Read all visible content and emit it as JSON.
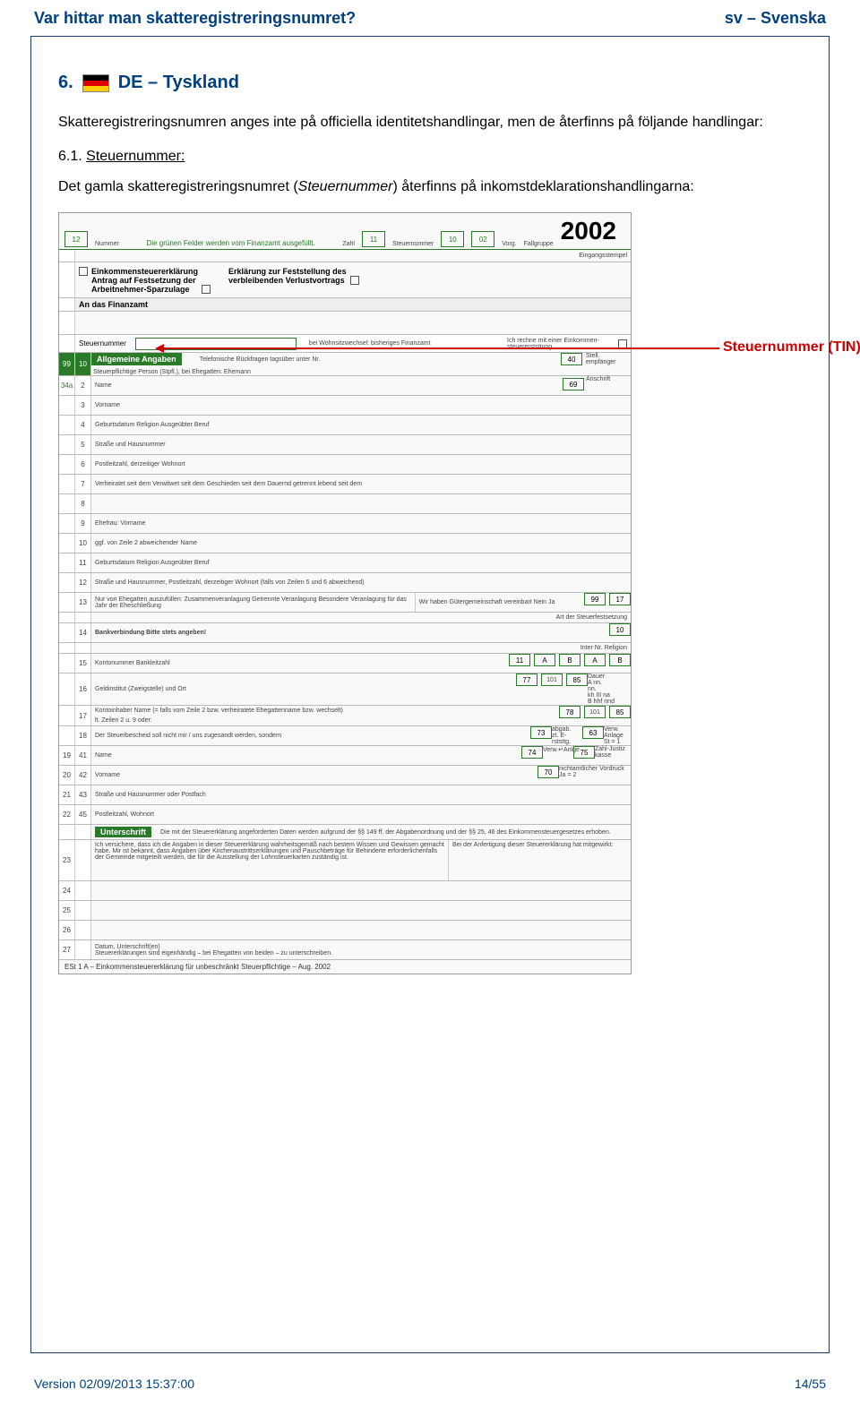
{
  "header": {
    "title_left": "Var hittar man skatteregistreringsnumret?",
    "title_right": "sv – Svenska"
  },
  "section": {
    "number": "6.",
    "country": "DE – Tyskland",
    "intro": "Skatteregistreringsnumren anges inte på officiella identitetshandlingar, men de återfinns på följande handlingar:",
    "sub_number": "6.1.",
    "sub_title": "Steuernummer:",
    "sub_body_prefix": "Det gamla skatteregistreringsnumret (",
    "sub_body_ital": "Steuernummer",
    "sub_body_suffix": ") återfinns på inkomstdeklarationshandlingarna:"
  },
  "annotation": {
    "label": "Steuernummer (TIN)"
  },
  "form": {
    "green_note": "Die grünen Felder werden vom Finanzamt ausgefüllt.",
    "year": "2002",
    "cells_top": [
      "12",
      "11",
      "10",
      "02"
    ],
    "top_small_labels": [
      "Nummer",
      "Zahl",
      "Steuernummer",
      "Vorg.",
      "Fallgruppe"
    ],
    "eingang": "Eingangsstempel",
    "decl_block": {
      "l1": "Einkommensteuererklärung",
      "l2": "Antrag auf Festsetzung der",
      "l3": "Arbeitnehmer-Sparzulage",
      "r1": "Erklärung zur Feststellung des",
      "r2": "verbleibenden Verlustvortrags"
    },
    "an_das": "An das Finanzamt",
    "steuer_label": "Steuernummer",
    "wohnsitz": "bei Wohnsitzwechsel: bisheriges Finanzamt",
    "rechne": "Ich rechne mit einer Einkommen-steuererststtung.",
    "allg": "Allgemeine Angaben",
    "allg_sub": "Steuerpflichtige Person (Stpfl.), bei Ehegatten: Ehemann",
    "tele": "Telefonische Rückfragen tagsüber unter Nr.",
    "rows": [
      {
        "n": "2",
        "t": "Name"
      },
      {
        "n": "3",
        "t": "Vorname"
      },
      {
        "n": "4",
        "t": "Geburtsdatum            Religion            Ausgeübter Beruf"
      },
      {
        "n": "5",
        "t": "Straße und Hausnummer"
      },
      {
        "n": "6",
        "t": "Postleitzahl, derzeitiger Wohnort"
      },
      {
        "n": "7",
        "t": "Verheiratet seit dem    Verwitwet seit dem    Geschieden seit dem    Dauernd getrennt lebend seit dem"
      },
      {
        "n": "8",
        "t": ""
      },
      {
        "n": "9",
        "t": "Ehefrau: Vorname"
      },
      {
        "n": "10",
        "t": "ggf. von Zeile 2 abweichender Name"
      },
      {
        "n": "11",
        "t": "Geburtsdatum            Religion            Ausgeübter Beruf"
      },
      {
        "n": "12",
        "t": "Straße und Hausnummer, Postleitzahl, derzeitiger Wohnort (falls von Zeilen 5 und 6 abweichend)"
      }
    ],
    "row13_left": "Nur von Ehegatten auszufüllen:  Zusammenveranlagung   Getrennte Veranlagung   Besondere Veranlagung für das Jahr der Eheschließung",
    "row13_right": "Wir haben Gütergemeinschaft vereinbart   Nein   Ja",
    "row14": "Bankverbindung   Bitte stets angeben!",
    "row15": "Kontonummer                                   Bankleitzahl",
    "row16": "Geldinstitut (Zweigstelle) und Ort",
    "row17": "Kontoinhaber   Name (= falls vom Zeile 2 bzw. verheiratete Ehegattenname bzw. wechselt)",
    "row17b": "lt. Zeilen 2 u. 9 oder:",
    "row18": "Der Steuerbescheid soll nicht mir / uns zugesandt werden, sondern",
    "row19": "Name",
    "row20": "Vorname",
    "row21": "Straße und Hausnummer oder Postfach",
    "row22": "Postleitzahl, Wohnort",
    "unterschrift": "Unterschrift",
    "unter_note": "Die mit der Steuererklärung angeforderten Daten werden aufgrund der §§ 149 ff. der Abgabenordnung und der §§ 25, 46 des Einkommensteuergesetzes erhoben.",
    "row23": "Ich versichere, dass ich die Angaben in dieser Steuererklärung wahrheitsgemäß nach bestem Wissen und Gewissen gemacht habe. Mir ist bekannt, dass Angaben über Kirchenaustrittserklärungen und Pauschbeträge für Behinderte erforderlichenfalls der Gemeinde mitgeteilt werden, die für die Ausstellung der Lohnsteuerkarten zuständig ist.",
    "row23r": "Bei der Anfertigung dieser Steuererklärung hat mitgewirkt:",
    "row27": "Datum, Unterschrift(en)\nSteuererklärungen sind eigenhändig – bei Ehegatten von beiden – zu unterschreiben.",
    "footer": "ESt 1 A – Einkommensteuererklärung für unbeschränkt Steuerpflichtige – Aug. 2002",
    "right_codes": {
      "r1": [
        "99",
        "10"
      ],
      "r1b": [
        "40"
      ],
      "r1c": "69",
      "r13": [
        "99",
        "17"
      ],
      "r14": "10",
      "r15": "11",
      "r16": [
        "77",
        "101",
        "85"
      ],
      "r17": [
        "78",
        "101",
        "85"
      ],
      "r18": [
        "73",
        "63"
      ],
      "r19": [
        "41",
        "74",
        "75"
      ],
      "r20": "70",
      "r21": "42",
      "r22": [
        "43",
        "45"
      ],
      "art": "Art der Steuerfestsetzung",
      "inter": "Inter  Nr.  Religion",
      "dauer": "Dauer\nA nn.\nnn.\nkh III na\nB hhf nnd",
      "abgab": "abgab.\nzt. E-\nrststtg.",
      "verw": "Verw.\nAnlage\nSt = 1",
      "zahlv": "Zahl-Justiz\nkasse",
      "rv": "nichtamtlicher Vordruck\nJa = 2",
      "stell": "Stell.\nempfänger",
      "amt": "Anschrift"
    }
  },
  "footer": {
    "version": "Version 02/09/2013 15:37:00",
    "page": "14/55"
  }
}
